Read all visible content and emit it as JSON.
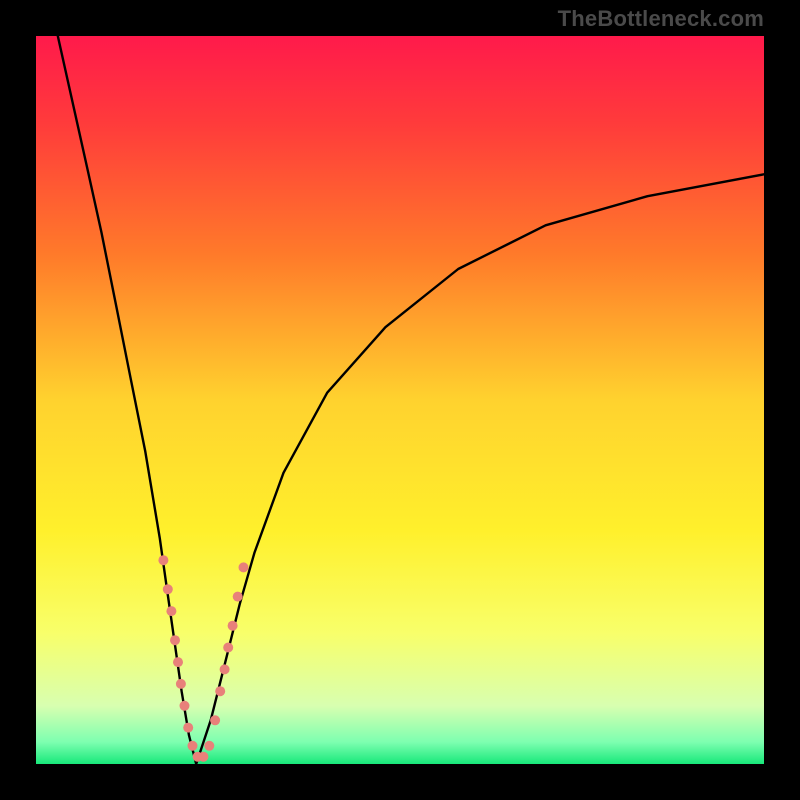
{
  "watermark": {
    "text": "TheBottleneck.com"
  },
  "gradient": {
    "stops": [
      {
        "offset": 0.0,
        "color": "#ff1a4b"
      },
      {
        "offset": 0.12,
        "color": "#ff3b3b"
      },
      {
        "offset": 0.3,
        "color": "#ff7a2a"
      },
      {
        "offset": 0.5,
        "color": "#ffd22e"
      },
      {
        "offset": 0.68,
        "color": "#fff02c"
      },
      {
        "offset": 0.82,
        "color": "#f8ff6a"
      },
      {
        "offset": 0.92,
        "color": "#d8ffb0"
      },
      {
        "offset": 0.97,
        "color": "#7dffb0"
      },
      {
        "offset": 1.0,
        "color": "#18e87a"
      }
    ]
  },
  "chart_data": {
    "type": "line",
    "title": "",
    "xlabel": "",
    "ylabel": "",
    "x_range": [
      0,
      100
    ],
    "y_range": [
      0,
      100
    ],
    "x_minimum": 22,
    "series": [
      {
        "name": "left-branch",
        "x": [
          3,
          5,
          7,
          9,
          11,
          13,
          15,
          17,
          18,
          19,
          20,
          21,
          22
        ],
        "y": [
          100,
          91,
          82,
          73,
          63,
          53,
          43,
          31,
          24,
          17,
          10,
          4,
          0
        ]
      },
      {
        "name": "right-branch",
        "x": [
          22,
          24,
          26,
          28,
          30,
          34,
          40,
          48,
          58,
          70,
          84,
          100
        ],
        "y": [
          0,
          6,
          14,
          22,
          29,
          40,
          51,
          60,
          68,
          74,
          78,
          81
        ]
      }
    ],
    "markers": {
      "name": "data-points",
      "color": "#e8817a",
      "points": [
        {
          "x": 17.5,
          "y": 28,
          "r": 5
        },
        {
          "x": 18.1,
          "y": 24,
          "r": 5
        },
        {
          "x": 18.6,
          "y": 21,
          "r": 5
        },
        {
          "x": 19.1,
          "y": 17,
          "r": 5
        },
        {
          "x": 19.5,
          "y": 14,
          "r": 5
        },
        {
          "x": 19.9,
          "y": 11,
          "r": 5
        },
        {
          "x": 20.4,
          "y": 8,
          "r": 5
        },
        {
          "x": 20.9,
          "y": 5,
          "r": 5
        },
        {
          "x": 21.5,
          "y": 2.5,
          "r": 5
        },
        {
          "x": 22.2,
          "y": 1,
          "r": 5
        },
        {
          "x": 23.0,
          "y": 1,
          "r": 5
        },
        {
          "x": 23.8,
          "y": 2.5,
          "r": 5
        },
        {
          "x": 24.6,
          "y": 6,
          "r": 5
        },
        {
          "x": 25.3,
          "y": 10,
          "r": 5
        },
        {
          "x": 25.9,
          "y": 13,
          "r": 5
        },
        {
          "x": 26.4,
          "y": 16,
          "r": 5
        },
        {
          "x": 27.0,
          "y": 19,
          "r": 5
        },
        {
          "x": 27.7,
          "y": 23,
          "r": 5
        },
        {
          "x": 28.5,
          "y": 27,
          "r": 5
        }
      ]
    }
  }
}
